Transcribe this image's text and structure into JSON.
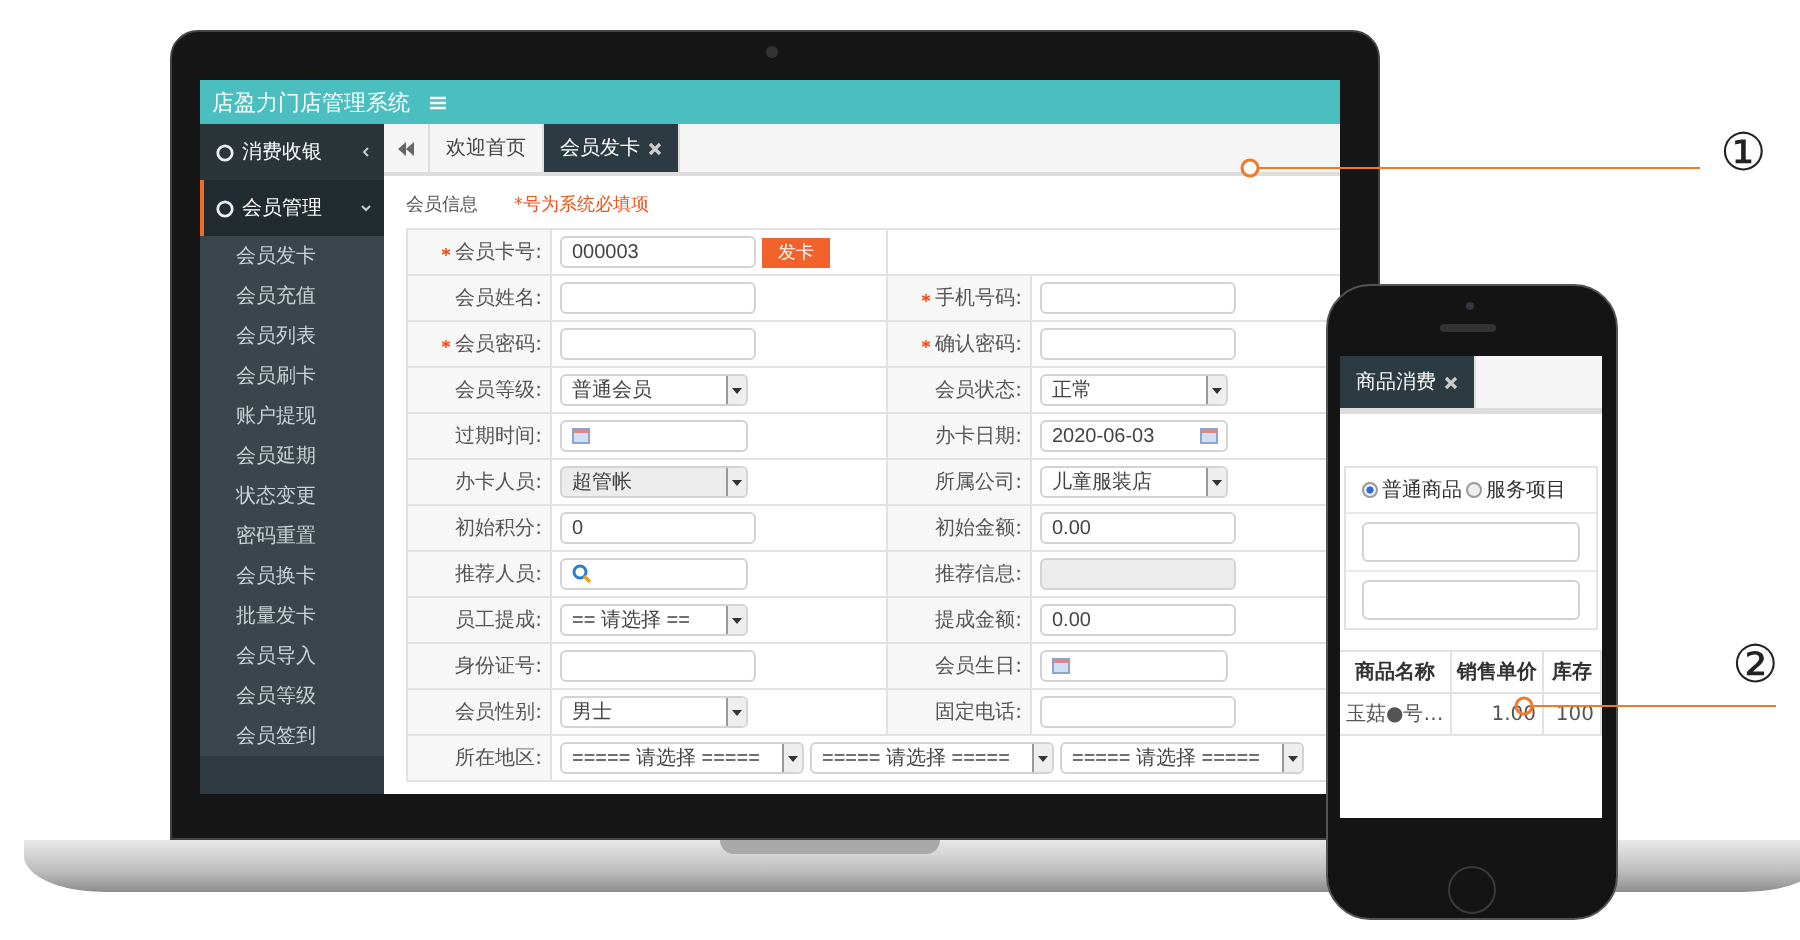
{
  "laptop": {
    "app_title": "店盈力门店管理系统",
    "sidebar": {
      "items": [
        {
          "label": "消费收银",
          "expanded": false
        },
        {
          "label": "会员管理",
          "expanded": true,
          "children": [
            "会员发卡",
            "会员充值",
            "会员列表",
            "会员刷卡",
            "账户提现",
            "会员延期",
            "状态变更",
            "密码重置",
            "会员换卡",
            "批量发卡",
            "会员导入",
            "会员等级",
            "会员签到"
          ]
        }
      ]
    },
    "tabs": [
      {
        "label": "欢迎首页",
        "selected": false,
        "closable": false
      },
      {
        "label": "会员发卡",
        "selected": true,
        "closable": true
      }
    ],
    "form": {
      "section_title": "会员信息",
      "required_note": "*号为系统必填项",
      "rows": [
        [
          {
            "label": "会员卡号:",
            "required": true,
            "kind": "card",
            "value": "000003",
            "button": "发卡",
            "disabled": false
          }
        ],
        [
          {
            "label": "会员姓名:",
            "required": false,
            "kind": "text",
            "disabled": false
          },
          {
            "label": "手机号码:",
            "required": true,
            "kind": "text",
            "disabled": false
          }
        ],
        [
          {
            "label": "会员密码:",
            "required": true,
            "kind": "text",
            "disabled": false
          },
          {
            "label": "确认密码:",
            "required": true,
            "kind": "text",
            "disabled": false
          }
        ],
        [
          {
            "label": "会员等级:",
            "required": false,
            "kind": "select",
            "value": "普通会员",
            "disabled": false
          },
          {
            "label": "会员状态:",
            "required": false,
            "kind": "select",
            "value": "正常",
            "disabled": false
          }
        ],
        [
          {
            "label": "过期时间:",
            "required": false,
            "kind": "date",
            "disabled": false
          },
          {
            "label": "办卡日期:",
            "required": false,
            "kind": "date",
            "value": "2020-06-03",
            "disabled": false
          }
        ],
        [
          {
            "label": "办卡人员:",
            "required": false,
            "kind": "select",
            "value": "超管帐",
            "disabled": true
          },
          {
            "label": "所属公司:",
            "required": false,
            "kind": "select",
            "value": "儿童服装店",
            "disabled": false
          }
        ],
        [
          {
            "label": "初始积分:",
            "required": false,
            "kind": "text",
            "value": "0",
            "disabled": false
          },
          {
            "label": "初始金额:",
            "required": false,
            "kind": "text",
            "value": "0.00",
            "disabled": false
          }
        ],
        [
          {
            "label": "推荐人员:",
            "required": false,
            "kind": "search",
            "disabled": false
          },
          {
            "label": "推荐信息:",
            "required": false,
            "kind": "text",
            "disabled": true
          }
        ],
        [
          {
            "label": "员工提成:",
            "required": false,
            "kind": "select",
            "value": "== 请选择 ==",
            "disabled": false
          },
          {
            "label": "提成金额:",
            "required": false,
            "kind": "text",
            "value": "0.00",
            "disabled": false
          }
        ],
        [
          {
            "label": "身份证号:",
            "required": false,
            "kind": "text",
            "disabled": false
          },
          {
            "label": "会员生日:",
            "required": false,
            "kind": "date",
            "disabled": false
          }
        ],
        [
          {
            "label": "会员性别:",
            "required": false,
            "kind": "select",
            "value": "男士",
            "disabled": false
          },
          {
            "label": "固定电话:",
            "required": false,
            "kind": "text",
            "disabled": false
          }
        ],
        [
          {
            "label": "所在地区:",
            "required": false,
            "kind": "region",
            "values": [
              "===== 请选择 =====",
              "===== 请选择 =====",
              "===== 请选择 ====="
            ],
            "disabled": false
          }
        ]
      ]
    }
  },
  "phone": {
    "tab": "商品消费",
    "radio_options": [
      {
        "label": "普通商品",
        "selected": true
      },
      {
        "label": "服务项目",
        "selected": false
      }
    ],
    "table": {
      "columns": [
        "商品名称",
        "销售单价",
        "库存"
      ],
      "rows": [
        [
          "玉菇●号…",
          "1.00",
          "100"
        ]
      ]
    }
  },
  "callouts": [
    "①",
    "②"
  ]
}
